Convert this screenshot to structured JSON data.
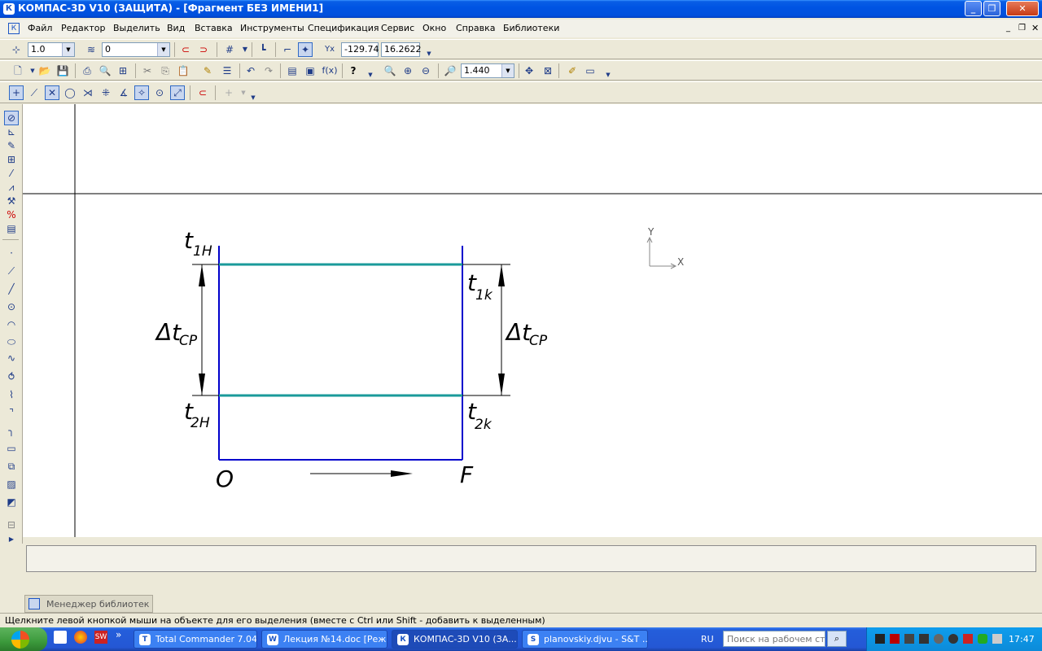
{
  "window": {
    "title": "КОМПАС-3D V10 (ЗАЩИТА) - [Фрагмент БЕЗ ИМЕНИ1]",
    "app_icon": "К"
  },
  "menu": [
    "Файл",
    "Редактор",
    "Выделить",
    "Вид",
    "Вставка",
    "Инструменты",
    "Спецификация",
    "Сервис",
    "Окно",
    "Справка",
    "Библиотеки"
  ],
  "toolbar1": {
    "step_value": "1.0",
    "layer_value": "0",
    "coord_x": "-129.74",
    "coord_y": "16.2622"
  },
  "toolbar2": {
    "zoom_value": "1.440",
    "function_label": "f(x)"
  },
  "drawing": {
    "labels": {
      "t1h": "t",
      "t1h_sub": "1H",
      "t2h": "t",
      "t2h_sub": "2H",
      "t1k": "t",
      "t1k_sub": "1k",
      "t2k": "t",
      "t2k_sub": "2k",
      "dt_left": "Δt",
      "dt_left_sub": "CP",
      "dt_right": "Δt",
      "dt_right_sub": "CP",
      "origin": "O",
      "end": "F"
    },
    "axis_y": "Y",
    "axis_x": "X",
    "colors": {
      "blue": "#0000cc",
      "teal": "#1a9a9a",
      "black": "#000000"
    }
  },
  "library_tab": "Менеджер библиотек",
  "status_text": "Щелкните левой кнопкой мыши на объекте для его выделения (вместе с Ctrl или Shift - добавить к выделенным)",
  "taskbar": {
    "items": [
      {
        "label": "Total Commander 7.04...",
        "icon": "T"
      },
      {
        "label": "Лекция №14.doc [Реж...",
        "icon": "W"
      },
      {
        "label": "КОМПАС-3D V10 (ЗА...",
        "icon": "К"
      },
      {
        "label": "planovskiy.djvu - S&T ...",
        "icon": "S"
      }
    ],
    "lang": "RU",
    "search_placeholder": "Поиск на рабочем столе",
    "clock": "17:47"
  }
}
